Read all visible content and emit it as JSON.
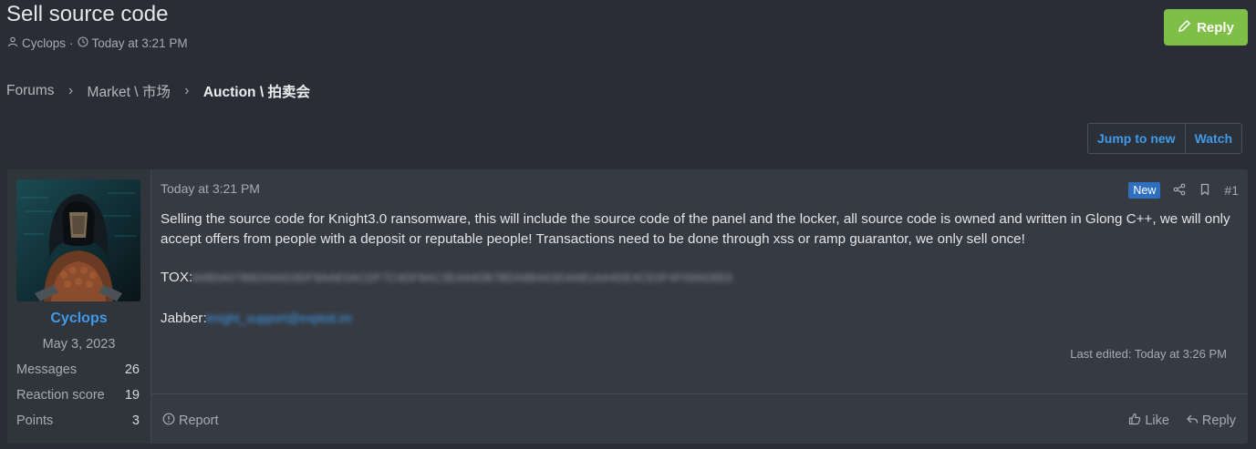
{
  "thread": {
    "title": "Sell source code",
    "author": "Cyclops",
    "meta_separator": "·",
    "date": "Today at 3:21 PM",
    "reply_label": "Reply"
  },
  "breadcrumb": {
    "items": [
      "Forums",
      "Market \\ 市场",
      "Auction \\ 拍卖会"
    ],
    "separator": "›"
  },
  "actions": {
    "jump_label": "Jump to new",
    "watch_label": "Watch"
  },
  "post": {
    "user": {
      "name": "Cyclops",
      "joined": "May 3, 2023",
      "stats": [
        {
          "label": "Messages",
          "value": "26"
        },
        {
          "label": "Reaction score",
          "value": "19"
        },
        {
          "label": "Points",
          "value": "3"
        }
      ]
    },
    "date": "Today at 3:21 PM",
    "badge": "New",
    "number": "#1",
    "body": "Selling the source code for Knight3.0 ransomware, this will include the source code of the panel and the locker, all source code is owned and written in Glong C++, we will only accept offers from people with a deposit or reputable people! Transactions need to be done through xss or ramp guarantor, we only sell once!",
    "tox_label": "TOX:",
    "tox_value": "8AB0A07B8204AD3DF9AAE0ACDF7C4DF8AC3EA64DB7BDA884A3D4AB1AA4DE4CE0F4F09AD6E6",
    "jabber_label": "Jabber:",
    "jabber_value": "knight_support@exploit.im",
    "last_edited": "Last edited: Today at 3:26 PM",
    "report_label": "Report",
    "like_label": "Like",
    "reply_label": "Reply"
  },
  "colors": {
    "background": "#2a2d35",
    "accent": "#3f9bea",
    "reply_button": "#80bf47",
    "badge_new": "#2f6fc0"
  }
}
